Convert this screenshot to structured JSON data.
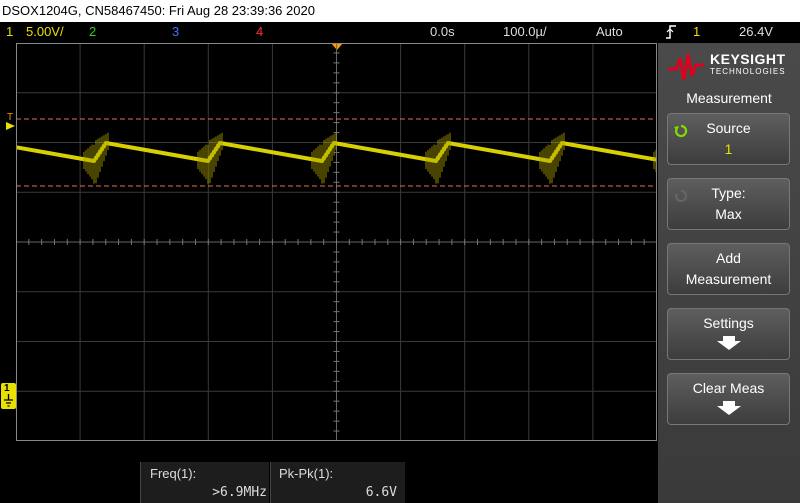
{
  "title": "DSOX1204G, CN58467450: Fri Aug 28 23:39:36 2020",
  "status": {
    "ch1_num": "1",
    "ch1_scale": "5.00V/",
    "ch2_num": "2",
    "ch3_num": "3",
    "ch4_num": "4",
    "time_delay": "0.0s",
    "time_scale": "100.0µ/",
    "trigger_mode": "Auto",
    "trigger_slope_icon": "rising-edge-icon",
    "trigger_source": "1",
    "trigger_level": "26.4V"
  },
  "colors": {
    "ch1": "#e8e000",
    "ch2": "#33cc33",
    "ch3": "#4a6cff",
    "ch4": "#ff3030",
    "trigger_marker": "#ff9900",
    "cursor_line": "#e07050",
    "accent_logo": "#e0001b"
  },
  "side_panel": {
    "brand": "KEYSIGHT",
    "brand_sub": "TECHNOLOGIES",
    "menu_title": "Measurement",
    "source_label": "Source",
    "source_value": "1",
    "type_label": "Type:",
    "type_value": "Max",
    "add_line1": "Add",
    "add_line2": "Measurement",
    "settings_label": "Settings",
    "clear_label": "Clear Meas"
  },
  "markers": {
    "trigger_level_marker": "T",
    "ground_marker": "1"
  },
  "measurements": [
    {
      "label": "Freq(1):",
      "value": ">6.9MHz"
    },
    {
      "label": "Pk-Pk(1):",
      "value": "6.6V"
    }
  ]
}
